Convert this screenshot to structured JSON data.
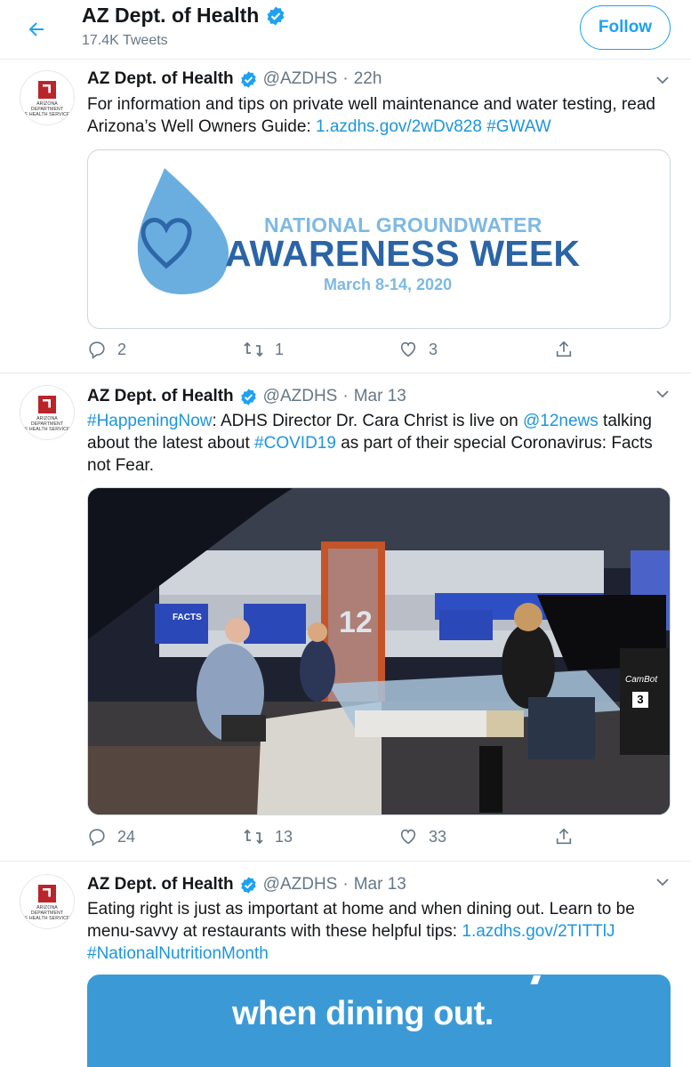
{
  "header": {
    "title": "AZ Dept. of Health",
    "tweet_count": "17.4K Tweets",
    "follow_label": "Follow"
  },
  "avatar": {
    "text_line1": "ARIZONA DEPARTMENT",
    "text_line2": "OF HEALTH SERVICES"
  },
  "tweets": [
    {
      "name": "AZ Dept. of Health",
      "handle": "@AZDHS",
      "dot": "·",
      "time": "22h",
      "text_1": "For information and tips on private well maintenance and water testing, read Arizona’s Well Owners Guide: ",
      "link_1": "1.azdhs.gov/2wDv828",
      "link_2": "#GWAW",
      "card": {
        "line1": "NATIONAL GROUNDWATER",
        "line2": "AWARENESS WEEK",
        "line3": "March 8-14, 2020"
      },
      "replies": "2",
      "retweets": "1",
      "likes": "3"
    },
    {
      "name": "AZ Dept. of Health",
      "handle": "@AZDHS",
      "dot": "·",
      "time": "Mar 13",
      "link_1": "#HappeningNow",
      "text_1": ": ADHS Director Dr. Cara Christ is live on ",
      "link_2": "@12news",
      "text_2": " talking about the latest about ",
      "link_3": "#COVID19",
      "text_3": " as part of their special Coronavirus: Facts not Fear.",
      "photo": {
        "screen_label": "FACTS",
        "desk_number": "12",
        "camera_label": "CamBot",
        "camera_number": "3"
      },
      "replies": "24",
      "retweets": "13",
      "likes": "33"
    },
    {
      "name": "AZ Dept. of Health",
      "handle": "@AZDHS",
      "dot": "·",
      "time": "Mar 13",
      "text_1": "Eating right is just as important at home and when dining out. Learn to be menu-savvy at restaurants with these helpful tips: ",
      "link_1": "1.azdhs.gov/2TITTlJ",
      "link_2": "#NationalNutritionMonth",
      "card_text": "when dining out."
    }
  ],
  "colors": {
    "link": "#1b95e0",
    "verified": "#1da1f2",
    "card_blue": "#3b9ad6",
    "meta_gray": "#657786"
  },
  "icons": [
    "back-arrow-icon",
    "verified-badge-icon",
    "chevron-down-icon",
    "reply-icon",
    "retweet-icon",
    "like-icon",
    "share-icon"
  ]
}
